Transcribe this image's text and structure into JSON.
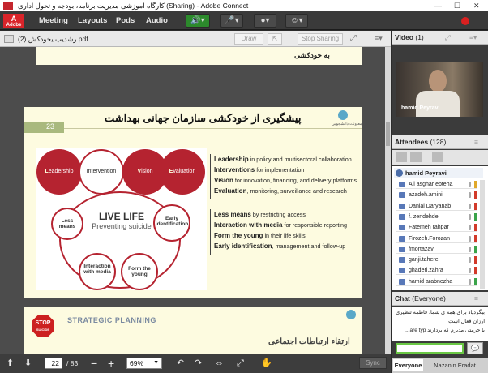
{
  "window": {
    "title": "کارگاه آموزشی مدیریت برنامه، بودجه و تحول اداری (Sharing) - Adobe Connect"
  },
  "menubar": {
    "logo": "Adobe",
    "items": [
      "Meeting",
      "Layouts",
      "Pods",
      "Audio"
    ]
  },
  "share_pod": {
    "filename": "(2) رشدیپ یخودکش.pdf",
    "draw_label": "Draw",
    "stop_sharing_label": "Stop Sharing",
    "slide_prev_text": "به خودکشی",
    "slide_number": "23",
    "slide_title": "پیشگیری از خودکشی سازمان جهانی بهداشت",
    "logo_text": "معاونت دانشجویی",
    "live_life": {
      "title": "LIVE LIFE",
      "subtitle": "Preventing suicide"
    },
    "top_circles": [
      {
        "initial": "L",
        "text": "eadership",
        "color": "#b52330"
      },
      {
        "initial": "",
        "text": "Intervention",
        "color": "#ffffff"
      },
      {
        "initial": "V",
        "text": "ision",
        "color": "#b52330"
      },
      {
        "initial": "E",
        "text": "valuation",
        "color": "#b52330"
      }
    ],
    "small_circles": {
      "less": "Less means",
      "early": "Early identification",
      "interaction": "Interaction with media",
      "form": "Form the young"
    },
    "bullets_top": [
      {
        "bold": "Leadership",
        "rest": " in policy and multisectoral collaboration"
      },
      {
        "bold": "Interventions",
        "rest": " for implementation"
      },
      {
        "bold": "Vision",
        "rest": " for innovation, financing, and delivery platforms"
      },
      {
        "bold": "Evaluation",
        "rest": ", monitoring, surveillance and research"
      }
    ],
    "bullets_bottom": [
      {
        "bold": "Less means",
        "rest": " by restricting access"
      },
      {
        "bold": "Interaction with media",
        "rest": " for responsible reporting"
      },
      {
        "bold": "Form the young",
        "rest": " in their life skills"
      },
      {
        "bold": "Early identification",
        "rest": ", management and follow-up"
      }
    ],
    "next_slide": {
      "stop_text": "STOP",
      "stop_sub": "SUICIDE",
      "strategic": "STRATEGIC PLANNING",
      "title": "ارتقاء ارتباطات اجتماعی"
    },
    "page_current": "22",
    "page_total": "/ 83",
    "zoom": "69%",
    "sync_label": "Sync"
  },
  "video_pod": {
    "title": "Video",
    "count": "(1)",
    "presenter": "hamid Peyravi"
  },
  "attendees_pod": {
    "title": "Attendees",
    "count": "(128)",
    "host": "hamid Peyravi",
    "list": [
      {
        "name": "Ali asghar ebteha",
        "status": "#e0a82a"
      },
      {
        "name": "azadeh.amini",
        "status": "#d23a2a"
      },
      {
        "name": "Danial Daryanab",
        "status": "#d23a2a"
      },
      {
        "name": "f. zendehdel",
        "status": "#3aa44a"
      },
      {
        "name": "Fatemeh rahpar",
        "status": "#d23a2a"
      },
      {
        "name": "Firozeh.Forozan",
        "status": "#d23a2a"
      },
      {
        "name": "fmortazavi",
        "status": "#3aa44a"
      },
      {
        "name": "ganji.tahere",
        "status": "#d23a2a"
      },
      {
        "name": "ghaderi.zahra",
        "status": "#d23a2a"
      },
      {
        "name": "hamid arabnezha",
        "status": "#3aa44a"
      }
    ]
  },
  "chat_pod": {
    "title": "Chat",
    "scope": "(Everyone)",
    "messages": [
      "بیگردیاد برای همه ی شما، فاطمه تنظیری",
      "ارزان فعال است",
      "با حرمتی مدیرم که بردارند are typ..."
    ],
    "tab_everyone": "Everyone",
    "tab_private": "Nazanin Eradat"
  }
}
